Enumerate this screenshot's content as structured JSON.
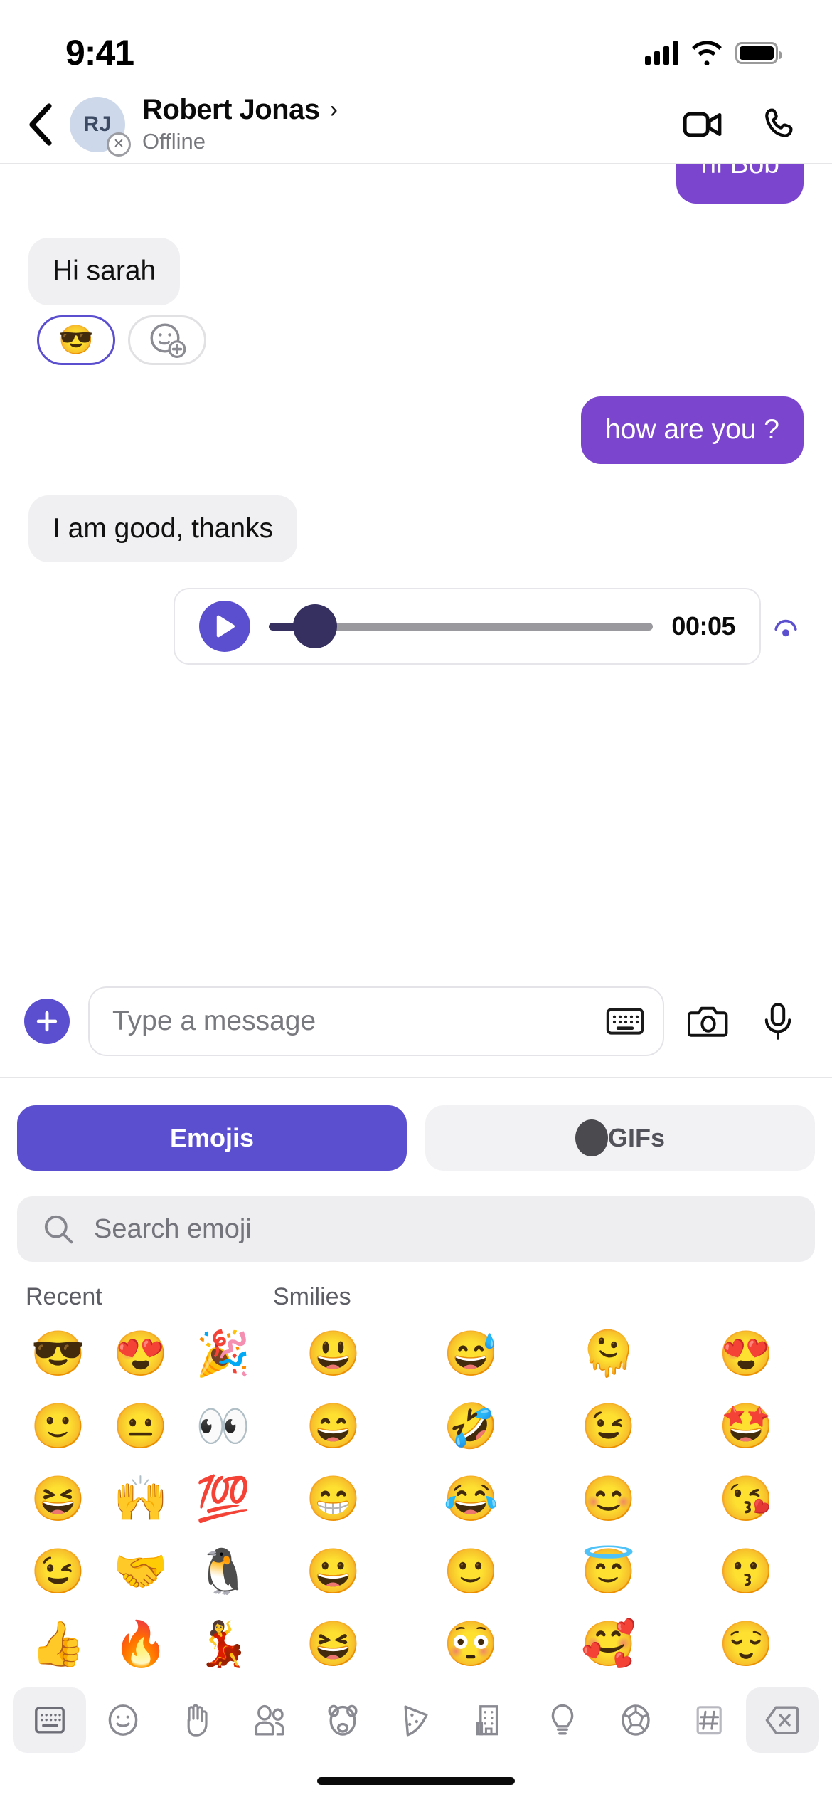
{
  "status_bar": {
    "time": "9:41",
    "signal_icon": "cellular-bars-icon",
    "wifi_icon": "wifi-icon",
    "battery_icon": "battery-full-icon"
  },
  "header": {
    "back_icon": "back-chevron-icon",
    "avatar_initials": "RJ",
    "presence_badge_icon": "offline-x-icon",
    "peer_name": "Robert Jonas",
    "name_chevron": "›",
    "peer_status": "Offline",
    "video_call_icon": "video-camera-icon",
    "voice_call_icon": "phone-icon"
  },
  "conversation": {
    "messages": [
      {
        "id": "m1",
        "side": "out",
        "text": "hi Bob",
        "clipped": true
      },
      {
        "id": "m2",
        "side": "in",
        "text": "Hi sarah",
        "clipped": false
      },
      {
        "id": "m3",
        "side": "out",
        "text": "how are you ?",
        "clipped": false
      },
      {
        "id": "m4",
        "side": "in",
        "text": "I am good, thanks",
        "clipped": false
      }
    ],
    "reactions": {
      "selected_emoji": "😎",
      "add_reaction_icon": "add-reaction-icon"
    },
    "voice_message": {
      "play_icon": "play-icon",
      "duration": "00:05",
      "progress_percent": 5,
      "delivery_icon": "sending-indicator-icon"
    }
  },
  "input_bar": {
    "attach_icon": "plus-icon",
    "placeholder": "Type a message",
    "value": "",
    "keyboard_icon": "keyboard-icon",
    "camera_icon": "camera-icon",
    "mic_icon": "microphone-icon"
  },
  "emoji_panel": {
    "tabs": [
      {
        "label": "Emojis",
        "active": true
      },
      {
        "label": "GIFs",
        "active": false,
        "icon": "gif-circle-icon"
      }
    ],
    "search": {
      "placeholder": "Search emoji",
      "value": "",
      "icon": "search-icon"
    },
    "sections": [
      {
        "title": "Recent",
        "columns": 3,
        "emojis": [
          "😎",
          "😍",
          "🎉",
          "🙂",
          "😐",
          "👀",
          "😆",
          "🙌",
          "💯",
          "😉",
          "🤝",
          "🐧",
          "👍",
          "🔥",
          "💃"
        ]
      },
      {
        "title": "Smilies",
        "columns": 4,
        "emojis": [
          "😃",
          "😅",
          "🫠",
          "😍",
          "😄",
          "🤣",
          "😉",
          "🤩",
          "😁",
          "😂",
          "😊",
          "😘",
          "😀",
          "🙂",
          "😇",
          "😗",
          "😆",
          "😳",
          "🥰",
          "😌"
        ]
      }
    ],
    "categories": [
      {
        "name": "keyboard-icon",
        "selected": true
      },
      {
        "name": "smiley-icon",
        "selected": false
      },
      {
        "name": "hand-icon",
        "selected": false
      },
      {
        "name": "people-icon",
        "selected": false
      },
      {
        "name": "animal-icon",
        "selected": false
      },
      {
        "name": "food-icon",
        "selected": false
      },
      {
        "name": "travel-building-icon",
        "selected": false
      },
      {
        "name": "object-bulb-icon",
        "selected": false
      },
      {
        "name": "activity-ball-icon",
        "selected": false
      },
      {
        "name": "symbols-hash-icon",
        "selected": false
      },
      {
        "name": "backspace-icon",
        "selected": false
      }
    ]
  },
  "colors": {
    "accent": "#5B4FCF",
    "bubble_out": "#7B45CE",
    "bubble_in": "#F0F0F2",
    "slider_thumb": "#353060"
  }
}
